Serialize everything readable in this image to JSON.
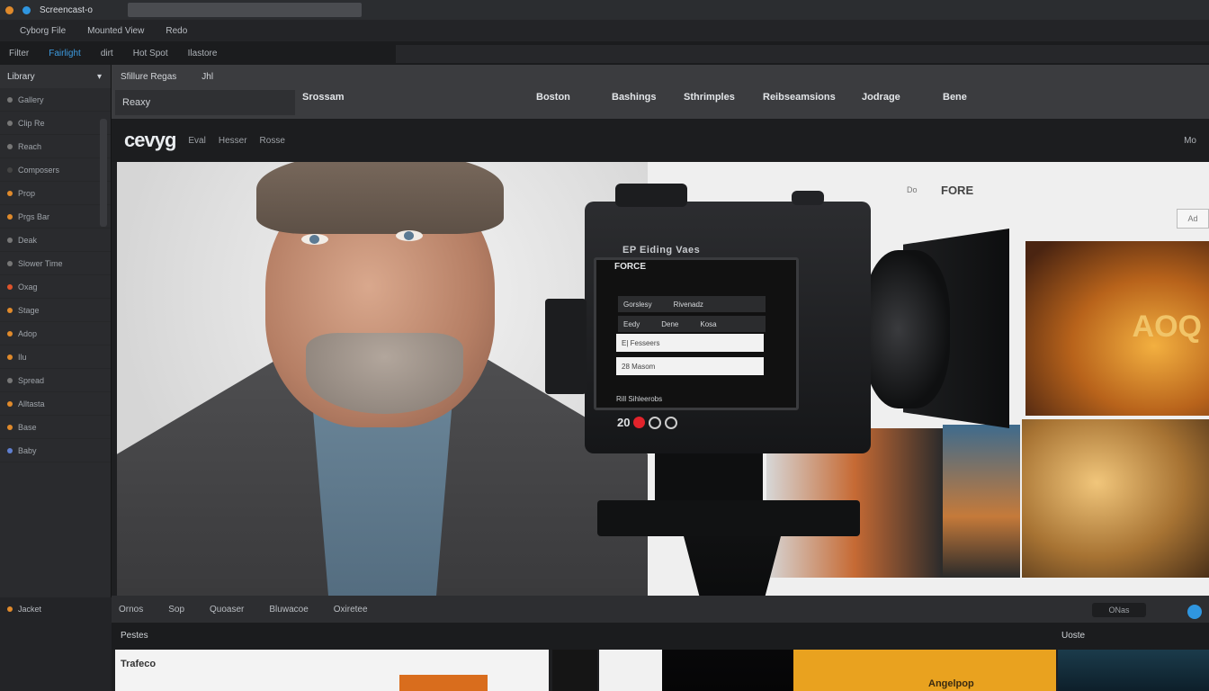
{
  "window": {
    "title": "Screencast-o",
    "menu": [
      "Cyborg File",
      "Mounted View",
      "Redo"
    ],
    "toolbar": [
      "Filter",
      "Fairlight",
      "dirt",
      "Hot Spot",
      "Ilastore"
    ]
  },
  "left_panel": {
    "header": "Library",
    "items": [
      {
        "label": "Gallery",
        "color": "#777"
      },
      {
        "label": "Clip Re",
        "color": "#777"
      },
      {
        "label": "Reach",
        "color": "#777"
      },
      {
        "label": "Composers",
        "color": "#444"
      },
      {
        "label": "Prop",
        "color": "#e08a2b"
      },
      {
        "label": "Prgs Bar",
        "color": "#e08a2b"
      },
      {
        "label": "Deak",
        "color": "#777"
      },
      {
        "label": "Slower Time",
        "color": "#777"
      },
      {
        "label": "Oxag",
        "color": "#e0542b"
      },
      {
        "label": "Stage",
        "color": "#e08a2b"
      },
      {
        "label": "Adop",
        "color": "#e08a2b"
      },
      {
        "label": "Ilu",
        "color": "#e08a2b"
      },
      {
        "label": "Spread",
        "color": "#777"
      },
      {
        "label": "Alltasta",
        "color": "#e08a2b"
      },
      {
        "label": "Base",
        "color": "#e08a2b"
      },
      {
        "label": "Baby",
        "color": "#5f7fd0"
      }
    ],
    "bottom_label": "Jacket"
  },
  "nav": {
    "tab_label": "Sfillure Regas",
    "tab_extra": "Jhl",
    "search_text": "Reaxy",
    "section": "Srossam",
    "links": [
      "Boston",
      "Bashings",
      "Sthrimples",
      "Reibseamsions",
      "Jodrage",
      "Bene"
    ]
  },
  "brand": {
    "logo": "cevyg",
    "items": [
      "Eval",
      "Hesser",
      "Rosse"
    ],
    "right": "Mo"
  },
  "viewer": {
    "fore_pre": "Do",
    "fore_label": "FORE",
    "mini_button": "Ad",
    "poster_title": "AOQ"
  },
  "camera": {
    "brand_label": "EP Eiding Vaes",
    "monitor_title": "FORCE",
    "bar1": [
      "Gorslesy",
      "Rivenadz"
    ],
    "bar2": [
      "Eedy",
      "Dene",
      "Kosa"
    ],
    "field1": "E| Fesseers",
    "field2": "28 Masom",
    "footer": "Rill Sihleerobs",
    "counter": "20"
  },
  "bottom": {
    "tabs": [
      "Ornos",
      "Sop",
      "Quoaser",
      "Bluwacoe",
      "Oxiretee"
    ],
    "button": "ONas",
    "subbar_left": "Pestes",
    "subbar_mid": "",
    "subbar_right": "Uoste",
    "strip1_text": "Trafeco",
    "strip4_text": "Angelpop"
  }
}
